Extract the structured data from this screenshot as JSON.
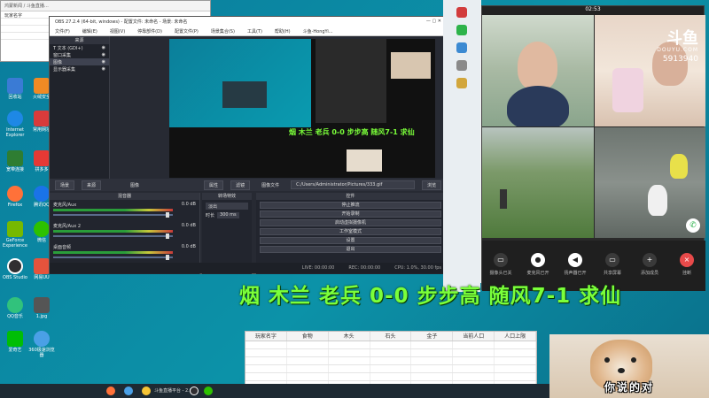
{
  "bg_window": {
    "title": "鸿蒙新闻 / 斗鱼直播…",
    "rows": [
      "玩家名字",
      "",
      "",
      "",
      ""
    ]
  },
  "desktop_icons": [
    {
      "label": "回收站",
      "color": "#3a7bd5"
    },
    {
      "label": "火绒安全",
      "color": "#f08a24"
    },
    {
      "label": "Internet Explorer",
      "color": "#1e88e5"
    },
    {
      "label": "常用网址",
      "color": "#d83b3b"
    },
    {
      "label": "宽带连接",
      "color": "#2e7d32"
    },
    {
      "label": "拼多多",
      "color": "#e53935"
    },
    {
      "label": "Firefox",
      "color": "#ff7139"
    },
    {
      "label": "腾讯QQ",
      "color": "#1a73e8"
    },
    {
      "label": "GeForce Experience",
      "color": "#76b900"
    },
    {
      "label": "微信",
      "color": "#2dc100"
    },
    {
      "label": "OBS Studio",
      "color": "#302e31"
    },
    {
      "label": "网易UU",
      "color": "#e5533c"
    },
    {
      "label": "QQ音乐",
      "color": "#31c27c"
    },
    {
      "label": "1.jpg",
      "color": "#555"
    },
    {
      "label": "爱奇艺",
      "color": "#00be06"
    },
    {
      "label": "360极速浏览器",
      "color": "#4aa0e6"
    }
  ],
  "obs": {
    "title": "OBS 27.2.4 (64-bit, windows) - 配置文件: 未命名 - 场景: 未命名",
    "menu": [
      "文件(F)",
      "编辑(E)",
      "视图(V)",
      "停靠部件(D)",
      "配置文件(P)",
      "场景集合(S)",
      "工具(T)",
      "帮助(H)",
      "斗鱼-HongYi..."
    ],
    "sources_header": "来源",
    "sources": [
      {
        "label": "T 文本 (GDI+)",
        "selected": false
      },
      {
        "label": "窗口采集",
        "selected": false
      },
      {
        "label": "图像",
        "selected": true
      },
      {
        "label": "显示器采集",
        "selected": false
      }
    ],
    "toolbar": {
      "tab_scenes": "场景",
      "tab_sources": "来源",
      "image": "图像",
      "props": "属性",
      "filters": "滤镜",
      "image_file": "图像文件",
      "path": "C:/Users/Administrator/Pictures/333.gif",
      "browse": "浏览"
    },
    "mixer_header": "混音器",
    "tracks": [
      {
        "name": "麦克风/Aux",
        "db": "0.0 dB"
      },
      {
        "name": "麦克风/Aux 2",
        "db": "0.0 dB"
      },
      {
        "name": "桌面音频",
        "db": "0.0 dB"
      }
    ],
    "transitions_header": "转场特效",
    "transition_type": "淡出",
    "duration_label": "时长",
    "duration_value": "300 ms",
    "controls_header": "控件",
    "controls": [
      "停止推流",
      "开始录制",
      "启动虚拟摄像机",
      "工作室模式",
      "设置",
      "退出"
    ],
    "status": {
      "live": "LIVE: 00:00:00",
      "rec": "REC: 00:00:00",
      "cpu": "CPU: 1.0%, 30.00 fps"
    },
    "preview_overlay": "烟 木兰 老兵 0-0 步步高 随风7-1 求仙"
  },
  "call": {
    "time": "02:53",
    "controls": [
      {
        "label": "摄像头已关",
        "icon": "▭",
        "state": "off"
      },
      {
        "label": "麦克风已开",
        "icon": "●",
        "state": "on"
      },
      {
        "label": "扬声器已开",
        "icon": "◀",
        "state": "on"
      },
      {
        "label": "共享屏幕",
        "icon": "▭",
        "state": "off"
      },
      {
        "label": "添加成员",
        "icon": "+",
        "state": "off"
      },
      {
        "label": "挂断",
        "icon": "×",
        "state": "red"
      }
    ]
  },
  "douyu": {
    "logo": "斗鱼",
    "domain": "DOUYU.COM",
    "room": "5913940"
  },
  "overlay_text": "烟 木兰 老兵 0-0 步步高 随风7-1 求仙",
  "sheet": {
    "headers": [
      "玩家名字",
      "食物",
      "木头",
      "石头",
      "金子",
      "当前人口",
      "人口上限"
    ]
  },
  "meme": {
    "caption": "你说的对"
  },
  "taskbar": {
    "item_label": "斗鱼直播平台 - 2.0..."
  }
}
